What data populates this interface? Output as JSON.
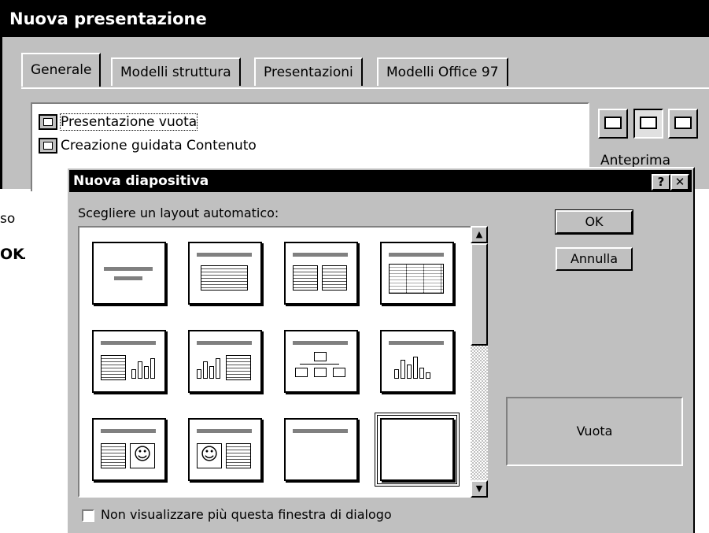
{
  "background_dialog": {
    "title": "Nuova presentazione",
    "tabs": [
      "Generale",
      "Modelli struttura",
      "Presentazioni",
      "Modelli Office 97"
    ],
    "list_items": [
      "Presentazione vuota",
      "Creazione guidata Contenuto"
    ],
    "preview_label": "Anteprima"
  },
  "side_text": {
    "line1": "so",
    "bold": "OK",
    "after": "."
  },
  "dialog": {
    "title": "Nuova diapositiva",
    "help_button": "?",
    "close_button": "✕",
    "layout_label": "Scegliere un layout automatico:",
    "ok_button": "OK",
    "cancel_button": "Annulla",
    "preview_name": "Vuota",
    "checkbox_label": "Non visualizzare più questa finestra di dialogo"
  },
  "layouts": [
    "title",
    "bulleted-list",
    "two-column-text",
    "table",
    "text-and-chart",
    "chart-and-text",
    "org-chart",
    "chart",
    "text-and-clip-art",
    "clip-art-and-text",
    "title-only",
    "blank"
  ],
  "selected_layout": "blank",
  "icons": [
    "presentation-icon",
    "wizard-icon",
    "large-icons-view-icon",
    "list-view-icon",
    "details-view-icon",
    "scroll-up-icon",
    "scroll-down-icon"
  ]
}
